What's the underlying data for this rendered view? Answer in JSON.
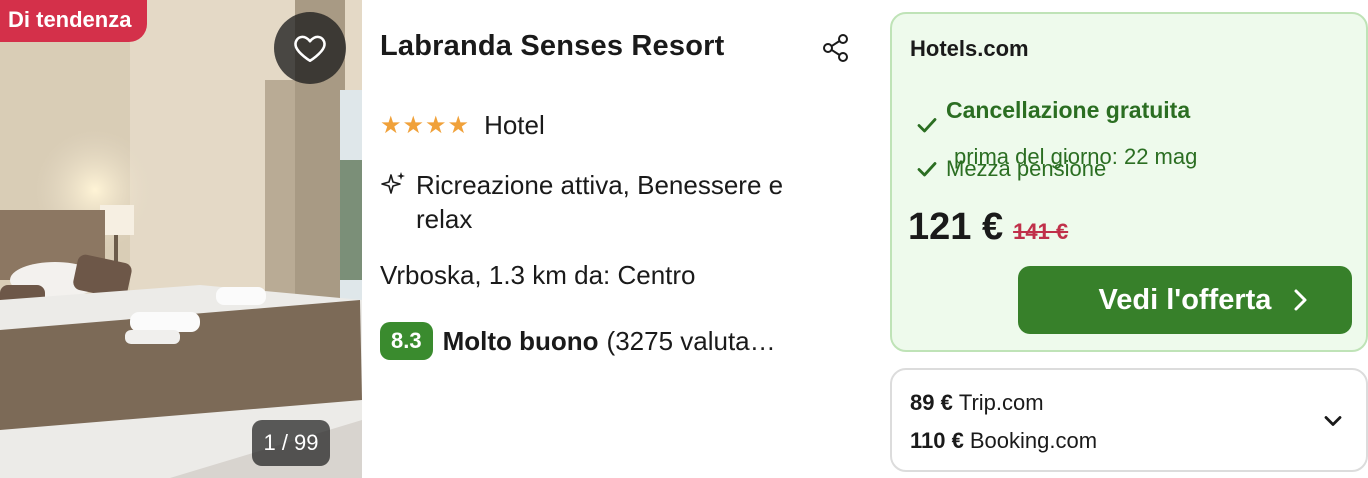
{
  "photo": {
    "badge": "Di tendenza",
    "counter": "1 / 99"
  },
  "hotel": {
    "name": "Labranda Senses Resort",
    "stars": "★★★★",
    "type": "Hotel",
    "feature": "Ricreazione attiva, Benessere e relax",
    "location": "Vrboska, 1.3 km da: Centro",
    "score": "8.3",
    "rating_label": "Molto buono",
    "reviews": "(3275 valuta…"
  },
  "offer": {
    "provider": "Hotels.com",
    "perk_cancel": "Cancellazione gratuita",
    "perk_cancel_detail": "prima del giorno: 22 mag",
    "perk_board": "Mezza pensione",
    "price": "121 €",
    "old_price": "141 €",
    "cta": "Vedi l'offerta"
  },
  "other_offers": [
    {
      "price": "89 €",
      "provider": "Trip.com"
    },
    {
      "price": "110 €",
      "provider": "Booking.com"
    }
  ],
  "colors": {
    "badge": "#d4304a",
    "score": "#3a8b2e",
    "cta": "#37802a",
    "offer_bg": "#eefaec",
    "old_price": "#c0304a",
    "stars": "#f0a13a"
  }
}
